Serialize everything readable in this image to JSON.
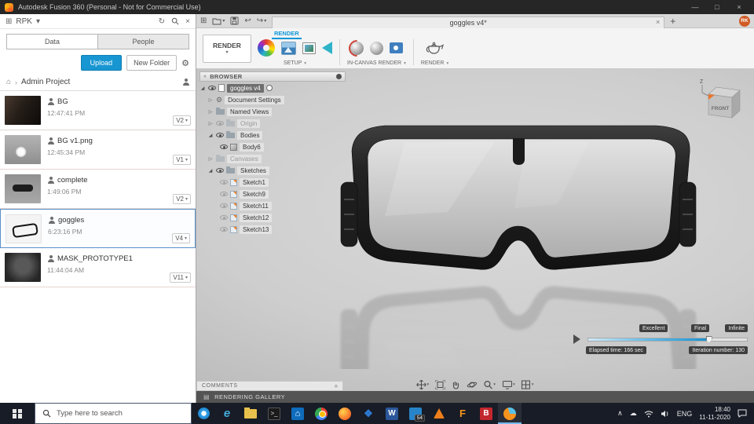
{
  "app": {
    "title": "Autodesk Fusion 360 (Personal - Not for Commercial Use)"
  },
  "icons": {
    "grid": "⊞",
    "chevron_down": "▾",
    "refresh": "↻",
    "close": "×",
    "gear": "⚙",
    "home": "⌂",
    "crumb_sep": "›",
    "undo": "↩",
    "redo": "↪",
    "minimize": "—",
    "maximize": "□",
    "collapse_left": "«",
    "tri_collapsed": "▷",
    "tri_expanded": "◢",
    "plus": "+",
    "tray_up": "∧",
    "cloud": "☁",
    "gallery": "▤",
    "comments_expand": "»"
  },
  "data_panel": {
    "workspace_label": "RPK",
    "tabs": [
      {
        "label": "Data"
      },
      {
        "label": "People"
      }
    ],
    "upload": "Upload",
    "new_folder": "New Folder",
    "breadcrumb": "Admin Project",
    "items": [
      {
        "name": "BG",
        "time": "12:47:41 PM",
        "version": "V2"
      },
      {
        "name": "BG v1.png",
        "time": "12:45:34 PM",
        "version": "V1"
      },
      {
        "name": "complete",
        "time": "1:49:06 PM",
        "version": "V2"
      },
      {
        "name": "goggles",
        "time": "6:23:16 PM",
        "version": "V4"
      },
      {
        "name": "MASK_PROTOTYPE1",
        "time": "11:44:04 AM",
        "version": "V11"
      }
    ]
  },
  "tabstrip": {
    "doc_tab": "goggles v4*",
    "user_initials": "RK"
  },
  "ribbon": {
    "workspace_button": "RENDER",
    "active_tab": "RENDER",
    "groups": [
      {
        "label": "SETUP"
      },
      {
        "label": "IN-CANVAS RENDER"
      },
      {
        "label": "RENDER"
      }
    ]
  },
  "browser": {
    "title": "BROWSER",
    "root_label": "goggles v4",
    "nodes": [
      {
        "label": "Document Settings"
      },
      {
        "label": "Named Views"
      },
      {
        "label": "Origin"
      },
      {
        "label": "Bodies"
      },
      {
        "label": "Body6"
      },
      {
        "label": "Canvases"
      },
      {
        "label": "Sketches"
      },
      {
        "label": "Sketch1"
      },
      {
        "label": "Sketch9"
      },
      {
        "label": "Sketch11"
      },
      {
        "label": "Sketch12"
      },
      {
        "label": "Sketch13"
      }
    ]
  },
  "viewport": {
    "viewcube_front": "FRONT",
    "axis_z": "Z",
    "quality_labels": [
      "Excellent",
      "Final",
      "Infinite"
    ],
    "elapsed": "Elapsed time: 166 sec",
    "iteration": "Iteration number: 130",
    "progress_pct": 76
  },
  "panels": {
    "comments": "COMMENTS",
    "gallery": "RENDERING GALLERY"
  },
  "taskbar": {
    "search_placeholder": "Type here to search",
    "badge_count": "54",
    "glyphs": {
      "edge": "e",
      "word": "W",
      "dropbox": "❖",
      "autodesk": "F",
      "b_app": "B"
    },
    "tray_lang": "ENG",
    "time": "18:40",
    "date": "11-11-2020"
  },
  "colors": {
    "accent": "#0a96d6",
    "fusion_orange": "#e9762d",
    "selection": "#5b8fc9"
  }
}
